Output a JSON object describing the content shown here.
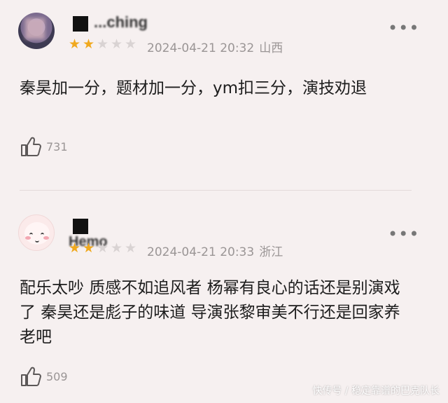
{
  "reviews": [
    {
      "username": "...ching",
      "rating": 2,
      "date": "2024-04-21 20:32",
      "location": "山西",
      "more_icon": "more-dots-icon",
      "text": "秦昊加一分，题材加一分，ym扣三分，演技劝退",
      "likes": "731",
      "like_icon": "thumbs-up-icon",
      "avatar_icon": "user-avatar"
    },
    {
      "username": "Hemo",
      "rating": 2,
      "date": "2024-04-21 20:33",
      "location": "浙江",
      "more_icon": "more-dots-icon",
      "text": "配乐太吵 质感不如追风者 杨幂有良心的话还是别演戏了 秦昊还是彪子的味道 导演张黎审美不行还是回家养老吧",
      "likes": "509",
      "like_icon": "thumbs-up-icon",
      "avatar_icon": "user-avatar"
    }
  ],
  "watermark": "快传号 / 稳定靠谱的巴克队长",
  "colors": {
    "background": "#f6f0f0",
    "star_filled": "#f0a91e",
    "star_empty": "#d9d3d3",
    "meta_text": "#9a9595"
  },
  "stars_total": 5
}
